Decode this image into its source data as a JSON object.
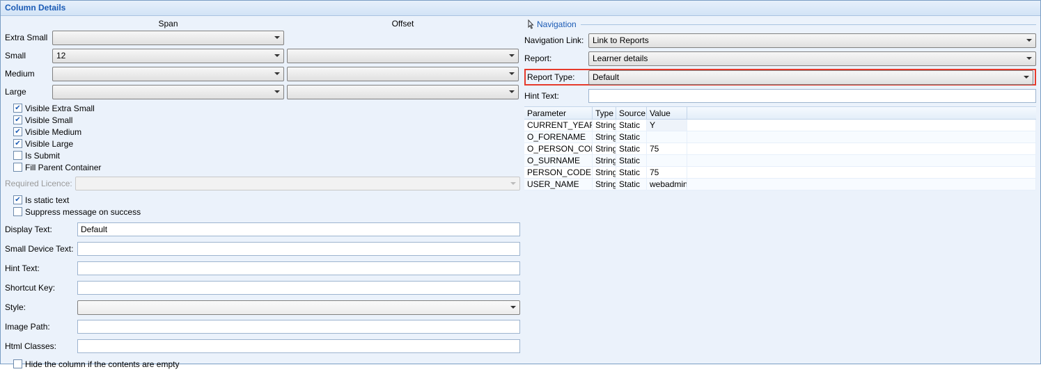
{
  "title": "Column Details",
  "span_grid": {
    "header_span": "Span",
    "header_offset": "Offset",
    "rows": [
      {
        "label": "Extra Small",
        "span": "",
        "offset": null
      },
      {
        "label": "Small",
        "span": "12",
        "offset": ""
      },
      {
        "label": "Medium",
        "span": "",
        "offset": ""
      },
      {
        "label": "Large",
        "span": "",
        "offset": ""
      }
    ]
  },
  "checks": {
    "visible_xs": {
      "label": "Visible Extra Small",
      "checked": true
    },
    "visible_sm": {
      "label": "Visible Small",
      "checked": true
    },
    "visible_md": {
      "label": "Visible Medium",
      "checked": true
    },
    "visible_lg": {
      "label": "Visible Large",
      "checked": true
    },
    "is_submit": {
      "label": "Is Submit",
      "checked": false
    },
    "fill_parent": {
      "label": "Fill Parent Container",
      "checked": false
    },
    "is_static": {
      "label": "Is static text",
      "checked": true
    },
    "suppress": {
      "label": "Suppress message on success",
      "checked": false
    },
    "hide_empty": {
      "label": "Hide the column if the contents are empty",
      "checked": false
    }
  },
  "required_licence_label": "Required Licence:",
  "fields": {
    "display_text": {
      "label": "Display Text:",
      "value": "Default"
    },
    "small_device_text": {
      "label": "Small Device Text:",
      "value": ""
    },
    "hint_text_left": {
      "label": "Hint Text:",
      "value": ""
    },
    "shortcut_key": {
      "label": "Shortcut Key:",
      "value": ""
    },
    "style": {
      "label": "Style:",
      "value": ""
    },
    "image_path": {
      "label": "Image Path:",
      "value": ""
    },
    "html_classes": {
      "label": "Html Classes:",
      "value": ""
    }
  },
  "nav": {
    "legend": "Navigation",
    "link": {
      "label": "Navigation Link:",
      "value": "Link to Reports"
    },
    "report": {
      "label": "Report:",
      "value": "Learner details"
    },
    "report_type": {
      "label": "Report Type:",
      "value": "Default"
    },
    "hint_text": {
      "label": "Hint Text:",
      "value": ""
    }
  },
  "param_headers": {
    "param": "Parameter",
    "type": "Type",
    "source": "Source",
    "value": "Value"
  },
  "params": [
    {
      "param": "CURRENT_YEAR",
      "type": "String",
      "source": "Static",
      "value": "Y"
    },
    {
      "param": "O_FORENAME",
      "type": "String",
      "source": "Static",
      "value": ""
    },
    {
      "param": "O_PERSON_CODE",
      "type": "String",
      "source": "Static",
      "value": "75"
    },
    {
      "param": "O_SURNAME",
      "type": "String",
      "source": "Static",
      "value": ""
    },
    {
      "param": "PERSON_CODE",
      "type": "String",
      "source": "Static",
      "value": "75"
    },
    {
      "param": "USER_NAME",
      "type": "String",
      "source": "Static",
      "value": "webadmin"
    }
  ]
}
